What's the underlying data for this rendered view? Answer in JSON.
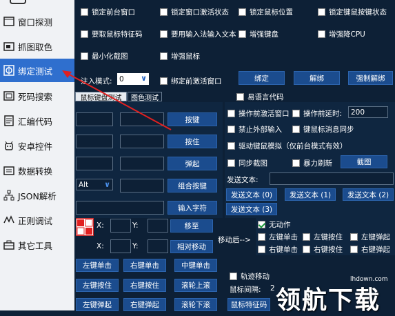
{
  "sidebar": {
    "items": [
      {
        "label": "窗口探测",
        "icon": "window-search-icon"
      },
      {
        "label": "抓图取色",
        "icon": "screenshot-icon"
      },
      {
        "label": "绑定测试",
        "icon": "bind-test-icon"
      },
      {
        "label": "死码搜索",
        "icon": "code-search-icon"
      },
      {
        "label": "汇编代码",
        "icon": "document-icon"
      },
      {
        "label": "安卓控件",
        "icon": "android-icon"
      },
      {
        "label": "数据转换",
        "icon": "data-convert-icon"
      },
      {
        "label": "JSON解析",
        "icon": "json-tree-icon"
      },
      {
        "label": "正则调试",
        "icon": "regex-icon"
      },
      {
        "label": "其它工具",
        "icon": "toolbox-icon"
      }
    ]
  },
  "options": {
    "row1": [
      "锁定前台窗口",
      "锁定窗口激活状态",
      "锁定鼠标位置",
      "锁定键鼠按键状态"
    ],
    "row2": [
      "要取鼠标特征码",
      "要用输入法输入文本",
      "增强键盘",
      "增强降CPU"
    ],
    "row3": [
      "最小化截图",
      "增强鼠标"
    ]
  },
  "bind": {
    "inject_label": "注入模式:",
    "inject_value": "0",
    "bind_before_activate": "绑定前激活窗口",
    "bind_btn": "绑定",
    "unbind_btn": "解绑",
    "force_unbind_btn": "强制解绑"
  },
  "tabs": {
    "kbm": "鼠标键盘测试",
    "image": "图色测试"
  },
  "easy_lang": "易语言代码",
  "keys": {
    "press": "按键",
    "hold": "按住",
    "release": "弹起",
    "combo": "组合按键",
    "input_chars": "输入字符",
    "alt_value": "Alt"
  },
  "right": {
    "activate_before": "操作前激活窗口",
    "delay_before": "操作前延时:",
    "delay_value": "200",
    "block_input": "禁止外部输入",
    "sync_msg": "键鼠标消息同步",
    "driver_sim": "驱动键鼠模拟（仅前台模式有效）",
    "sync_screenshot": "同步截图",
    "brute_refresh": "暴力刷新",
    "screenshot_btn": "截图",
    "send_text_label": "发送文本:",
    "send0": "发送文本 (0)",
    "send1": "发送文本 (1)",
    "send2": "发送文本 (2)",
    "send3": "发送文本 (3)"
  },
  "move": {
    "x": "X:",
    "y": "Y:",
    "move_to": "移至",
    "relative_move": "相对移动",
    "after_move": "移动后-->",
    "no_action": "无动作",
    "left_click": "左键单击",
    "left_hold": "左键按住",
    "left_release": "左键弹起",
    "right_click": "右键单击",
    "right_hold": "右键按住",
    "right_release": "右键弹起"
  },
  "mouse_btns": [
    "左键单击",
    "右键单击",
    "中键单击",
    "左键按住",
    "右键按住",
    "滚轮上滚",
    "左键弹起",
    "右键弹起",
    "滚轮下滚"
  ],
  "trace": {
    "track_move": "轨迹移动",
    "mouse_interval": "鼠标间隔:",
    "interval_value": "2",
    "mouse_feature_code": "鼠标特征码"
  },
  "watermark": {
    "url": "lhdown.com",
    "brand": "领航下载"
  }
}
